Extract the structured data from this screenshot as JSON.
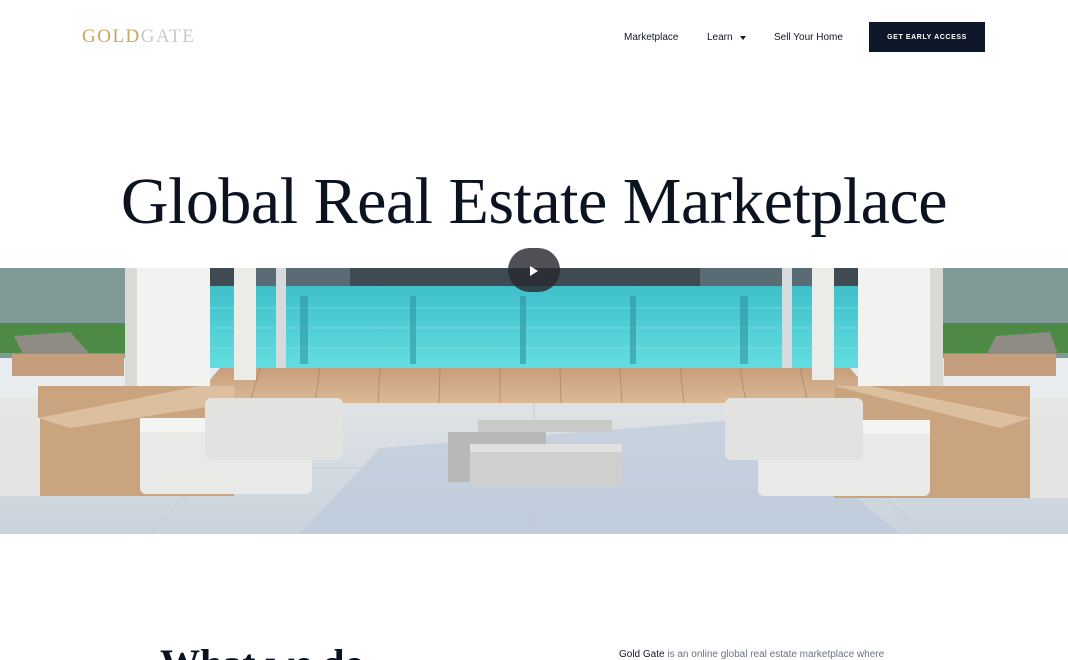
{
  "header": {
    "logo": {
      "part1": "GOLD",
      "part2": "GATE"
    },
    "nav": {
      "marketplace": "Marketplace",
      "learn": "Learn",
      "sell": "Sell Your Home"
    },
    "cta_label": "GET EARLY ACCESS"
  },
  "hero": {
    "title": "Global Real Estate Marketplace"
  },
  "about": {
    "heading": "What we do",
    "brand": "Gold Gate",
    "text": " is an online global real estate marketplace where"
  },
  "colors": {
    "brand_gold": "#c8a75d",
    "cta_background": "#0f172a",
    "pool": "#49cfd6"
  },
  "icons": [
    "chevron-down-icon",
    "play-icon"
  ]
}
